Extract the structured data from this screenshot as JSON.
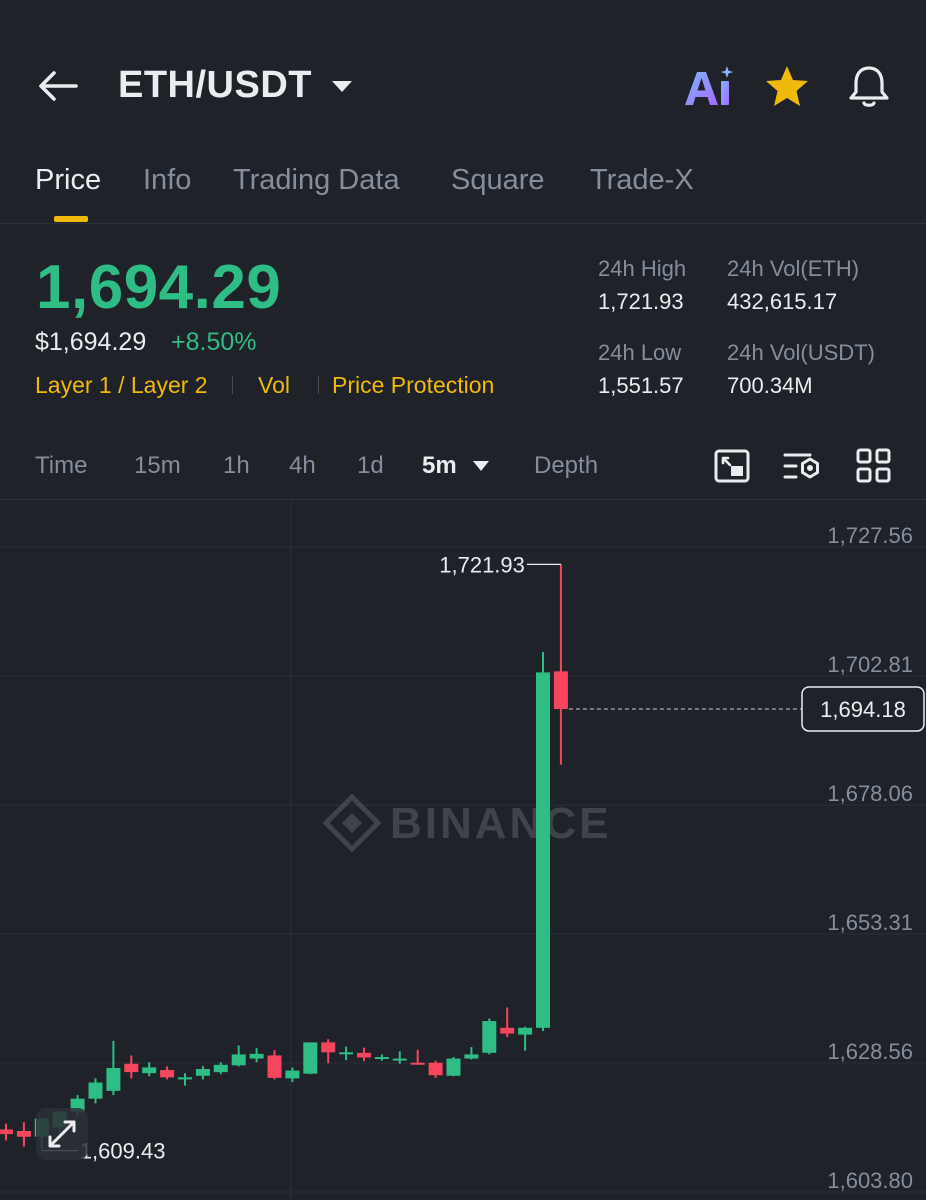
{
  "header": {
    "pair": "ETH/USDT",
    "icons": [
      "back-arrow-icon",
      "dropdown-caret-icon",
      "ai-icon",
      "star-icon",
      "bell-icon"
    ]
  },
  "tabs": [
    {
      "label": "Price",
      "active": true
    },
    {
      "label": "Info",
      "active": false
    },
    {
      "label": "Trading Data",
      "active": false
    },
    {
      "label": "Square",
      "active": false
    },
    {
      "label": "Trade-X",
      "active": false
    }
  ],
  "price": {
    "last": "1,694.29",
    "usd": "$1,694.29",
    "change": "+8.50%",
    "tags": [
      "Layer 1 / Layer 2",
      "Vol",
      "Price Protection"
    ]
  },
  "stats": {
    "high_label": "24h High",
    "high_value": "1,721.93",
    "vol_eth_label": "24h Vol(ETH)",
    "vol_eth_value": "432,615.17",
    "low_label": "24h Low",
    "low_value": "1,551.57",
    "vol_usdt_label": "24h Vol(USDT)",
    "vol_usdt_value": "700.34M"
  },
  "intervals": {
    "items": [
      "Time",
      "15m",
      "1h",
      "4h",
      "1d",
      "5m",
      "Depth"
    ],
    "active": "5m",
    "tools": [
      "chart-fullscreen-icon",
      "indicator-settings-icon",
      "grid-layout-icon"
    ]
  },
  "colors": {
    "up": "#2ebd85",
    "down": "#f6465d",
    "accent": "#f0b90b",
    "background": "#1f2229"
  },
  "chart_data": {
    "type": "candlestick",
    "watermark": "BINANCE",
    "ylim": [
      1603.8,
      1727.56
    ],
    "y_ticks": [
      "1,727.56",
      "1,702.81",
      "1,678.06",
      "1,653.31",
      "1,628.56",
      "1,603.80"
    ],
    "y_tick_values": [
      1727.56,
      1702.81,
      1678.06,
      1653.31,
      1628.56,
      1603.8
    ],
    "current_price_label": "1,694.18",
    "current_price": 1694.18,
    "high_label": "1,721.93",
    "high_value": 1721.93,
    "low_label": "1,609.43",
    "low_value": 1609.43,
    "candles": [
      {
        "o": 1613.5,
        "h": 1614.6,
        "l": 1611.4,
        "c": 1612.6
      },
      {
        "o": 1613.2,
        "h": 1614.9,
        "l": 1610.2,
        "c": 1612.1
      },
      {
        "o": 1612.1,
        "h": 1614.9,
        "l": 1609.43,
        "c": 1615.6
      },
      {
        "o": 1613.9,
        "h": 1617.1,
        "l": 1612.9,
        "c": 1616.9
      },
      {
        "o": 1616.9,
        "h": 1620.1,
        "l": 1616.1,
        "c": 1619.4
      },
      {
        "o": 1619.4,
        "h": 1623.3,
        "l": 1618.5,
        "c": 1622.5
      },
      {
        "o": 1620.9,
        "h": 1630.5,
        "l": 1620.1,
        "c": 1625.3
      },
      {
        "o": 1626.1,
        "h": 1627.7,
        "l": 1623.3,
        "c": 1624.5
      },
      {
        "o": 1624.3,
        "h": 1626.4,
        "l": 1623.7,
        "c": 1625.4
      },
      {
        "o": 1624.9,
        "h": 1625.6,
        "l": 1623.1,
        "c": 1623.5
      },
      {
        "o": 1623.1,
        "h": 1624.3,
        "l": 1621.9,
        "c": 1623.5
      },
      {
        "o": 1623.8,
        "h": 1625.7,
        "l": 1623.1,
        "c": 1625.1
      },
      {
        "o": 1624.5,
        "h": 1626.4,
        "l": 1624.1,
        "c": 1625.9
      },
      {
        "o": 1625.8,
        "h": 1629.6,
        "l": 1625.6,
        "c": 1627.9
      },
      {
        "o": 1627.1,
        "h": 1629.1,
        "l": 1626.4,
        "c": 1628.0
      },
      {
        "o": 1627.7,
        "h": 1628.7,
        "l": 1623.1,
        "c": 1623.4
      },
      {
        "o": 1623.3,
        "h": 1625.4,
        "l": 1622.6,
        "c": 1624.8
      },
      {
        "o": 1624.2,
        "h": 1630.2,
        "l": 1624.1,
        "c": 1630.2
      },
      {
        "o": 1630.2,
        "h": 1630.8,
        "l": 1626.2,
        "c": 1628.3
      },
      {
        "o": 1628.1,
        "h": 1629.4,
        "l": 1626.8,
        "c": 1628.3
      },
      {
        "o": 1628.2,
        "h": 1629.2,
        "l": 1626.6,
        "c": 1627.3
      },
      {
        "o": 1627.1,
        "h": 1627.9,
        "l": 1626.7,
        "c": 1627.4
      },
      {
        "o": 1627.0,
        "h": 1628.5,
        "l": 1626.1,
        "c": 1627.1
      },
      {
        "o": 1626.3,
        "h": 1628.8,
        "l": 1625.9,
        "c": 1626.2
      },
      {
        "o": 1626.3,
        "h": 1626.7,
        "l": 1623.4,
        "c": 1623.9
      },
      {
        "o": 1623.8,
        "h": 1627.4,
        "l": 1623.7,
        "c": 1627.1
      },
      {
        "o": 1627.1,
        "h": 1629.3,
        "l": 1626.9,
        "c": 1627.9
      },
      {
        "o": 1628.2,
        "h": 1634.8,
        "l": 1627.9,
        "c": 1634.3
      },
      {
        "o": 1633.0,
        "h": 1636.9,
        "l": 1631.2,
        "c": 1631.9
      },
      {
        "o": 1631.7,
        "h": 1633.2,
        "l": 1628.6,
        "c": 1633.0
      },
      {
        "o": 1633.0,
        "h": 1705.1,
        "l": 1632.4,
        "c": 1701.2
      },
      {
        "o": 1701.4,
        "h": 1721.93,
        "l": 1683.5,
        "c": 1694.18
      }
    ]
  }
}
